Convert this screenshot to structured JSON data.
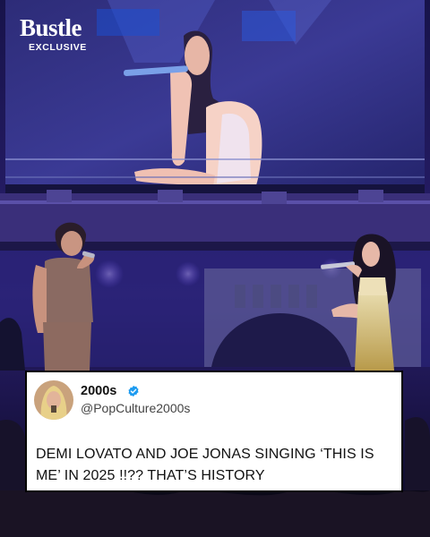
{
  "brand": {
    "name": "Bustle",
    "label": "EXCLUSIVE"
  },
  "tweet": {
    "display_name": "2000s",
    "handle": "@PopCulture2000s",
    "text": "DEMI LOVATO AND JOE JONAS SINGING ‘THIS IS ME’ IN 2025 !!?? THAT’S HISTORY",
    "verified_icon": "verified-badge-icon",
    "verified_color": "#1d9bf0"
  }
}
